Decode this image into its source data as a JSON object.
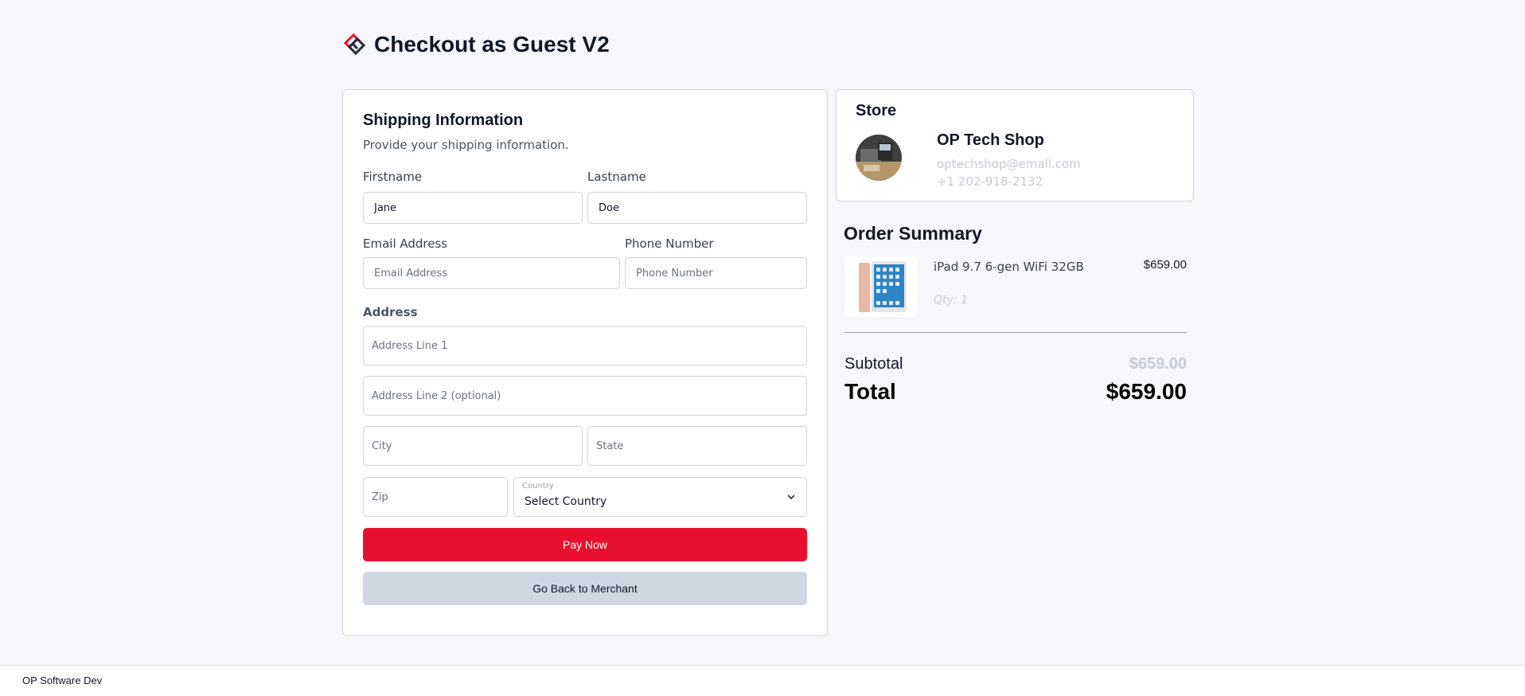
{
  "header": {
    "title": "Checkout as Guest V2",
    "logo_icon": "brand-diamond-logo-icon"
  },
  "shipping": {
    "title": "Shipping Information",
    "subtitle": "Provide your shipping information.",
    "firstname": {
      "label": "Firstname",
      "value": "Jane"
    },
    "lastname": {
      "label": "Lastname",
      "value": "Doe"
    },
    "email": {
      "label": "Email Address",
      "placeholder": "Email Address",
      "value": ""
    },
    "phone": {
      "label": "Phone Number",
      "placeholder": "Phone Number",
      "value": ""
    },
    "address": {
      "label": "Address",
      "line1_placeholder": "Address Line 1",
      "line2_placeholder": "Address Line 2 (optional)",
      "city_placeholder": "City",
      "state_placeholder": "State",
      "zip_placeholder": "Zip",
      "country_label": "Country",
      "country_value": "Select Country"
    },
    "pay_button": "Pay Now",
    "back_button": "Go Back to Merchant"
  },
  "store": {
    "heading": "Store",
    "name": "OP Tech Shop",
    "email": "optechshop@email.com",
    "phone": "+1 202-918-2132"
  },
  "summary": {
    "title": "Order Summary",
    "items": [
      {
        "name": "iPad 9.7 6-gen WiFi 32GB",
        "price": "$659.00",
        "qty": "Qty: 1"
      }
    ],
    "subtotal_label": "Subtotal",
    "subtotal_value": "$659.00",
    "total_label": "Total",
    "total_value": "$659.00"
  },
  "footer": {
    "text": "OP Software Dev"
  },
  "colors": {
    "accent": "#e8112d",
    "secondary_button": "#d0d6e2",
    "background": "#f7f7fb"
  }
}
